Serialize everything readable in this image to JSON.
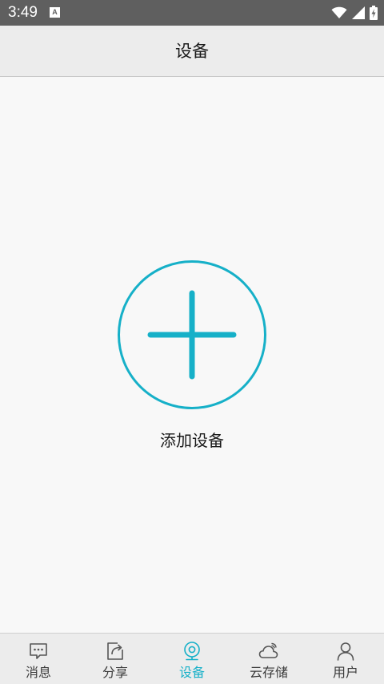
{
  "status_bar": {
    "time": "3:49",
    "notification_letter": "A"
  },
  "header": {
    "title": "设备"
  },
  "main": {
    "add_device_label": "添加设备"
  },
  "tabs": [
    {
      "label": "消息",
      "icon": "message-icon",
      "active": false
    },
    {
      "label": "分享",
      "icon": "share-icon",
      "active": false
    },
    {
      "label": "设备",
      "icon": "camera-icon",
      "active": true
    },
    {
      "label": "云存储",
      "icon": "cloud-icon",
      "active": false
    },
    {
      "label": "用户",
      "icon": "user-icon",
      "active": false
    }
  ],
  "colors": {
    "accent": "#16b0c8",
    "status_bar": "#5f5f5f",
    "header_bg": "#ececec",
    "body_bg": "#f8f8f8",
    "tab_icon": "#555555"
  }
}
